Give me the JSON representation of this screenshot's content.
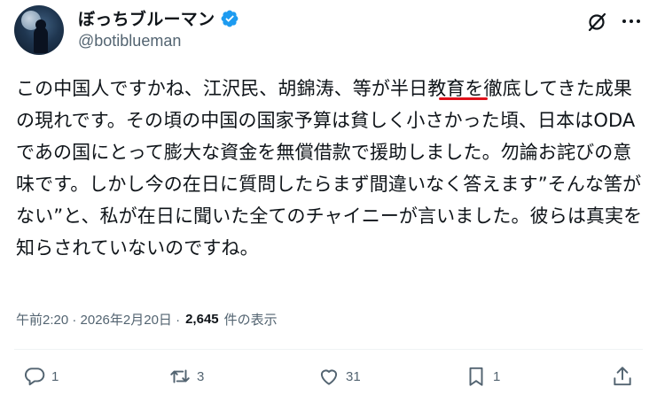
{
  "user": {
    "display_name": "ぼっちブルーマン",
    "handle": "@botiblueman"
  },
  "tweet": {
    "text": "この中国人ですかね、江沢民、胡錦涛、等が半日教育を徹底してきた成果の現れです。その頃の中国の国家予算は貧しく小さかった頃、日本はODAであの国にとって膨大な資金を無償借款で援助しました。勿論お詫びの意味です。しかし今の在日に質問したらまず間違いなく答えます”そんな筈がない”と、私が在日に聞いた全てのチャイニーが言いました。彼らは真実を知らされていないのですね。",
    "timestamp": "午前2:20 · 2026年2月20日 ·",
    "views": "2,645",
    "views_label": "件の表示"
  },
  "actions": {
    "reply_count": "1",
    "retweet_count": "3",
    "like_count": "31",
    "bookmark_count": "1"
  },
  "colors": {
    "accent": "#1d9bf0",
    "muted": "#536471",
    "underline": "#e0101a"
  },
  "icons": [
    "verified-badge-icon",
    "grok-icon",
    "more-icon",
    "reply-icon",
    "retweet-icon",
    "like-icon",
    "bookmark-icon",
    "share-icon"
  ]
}
